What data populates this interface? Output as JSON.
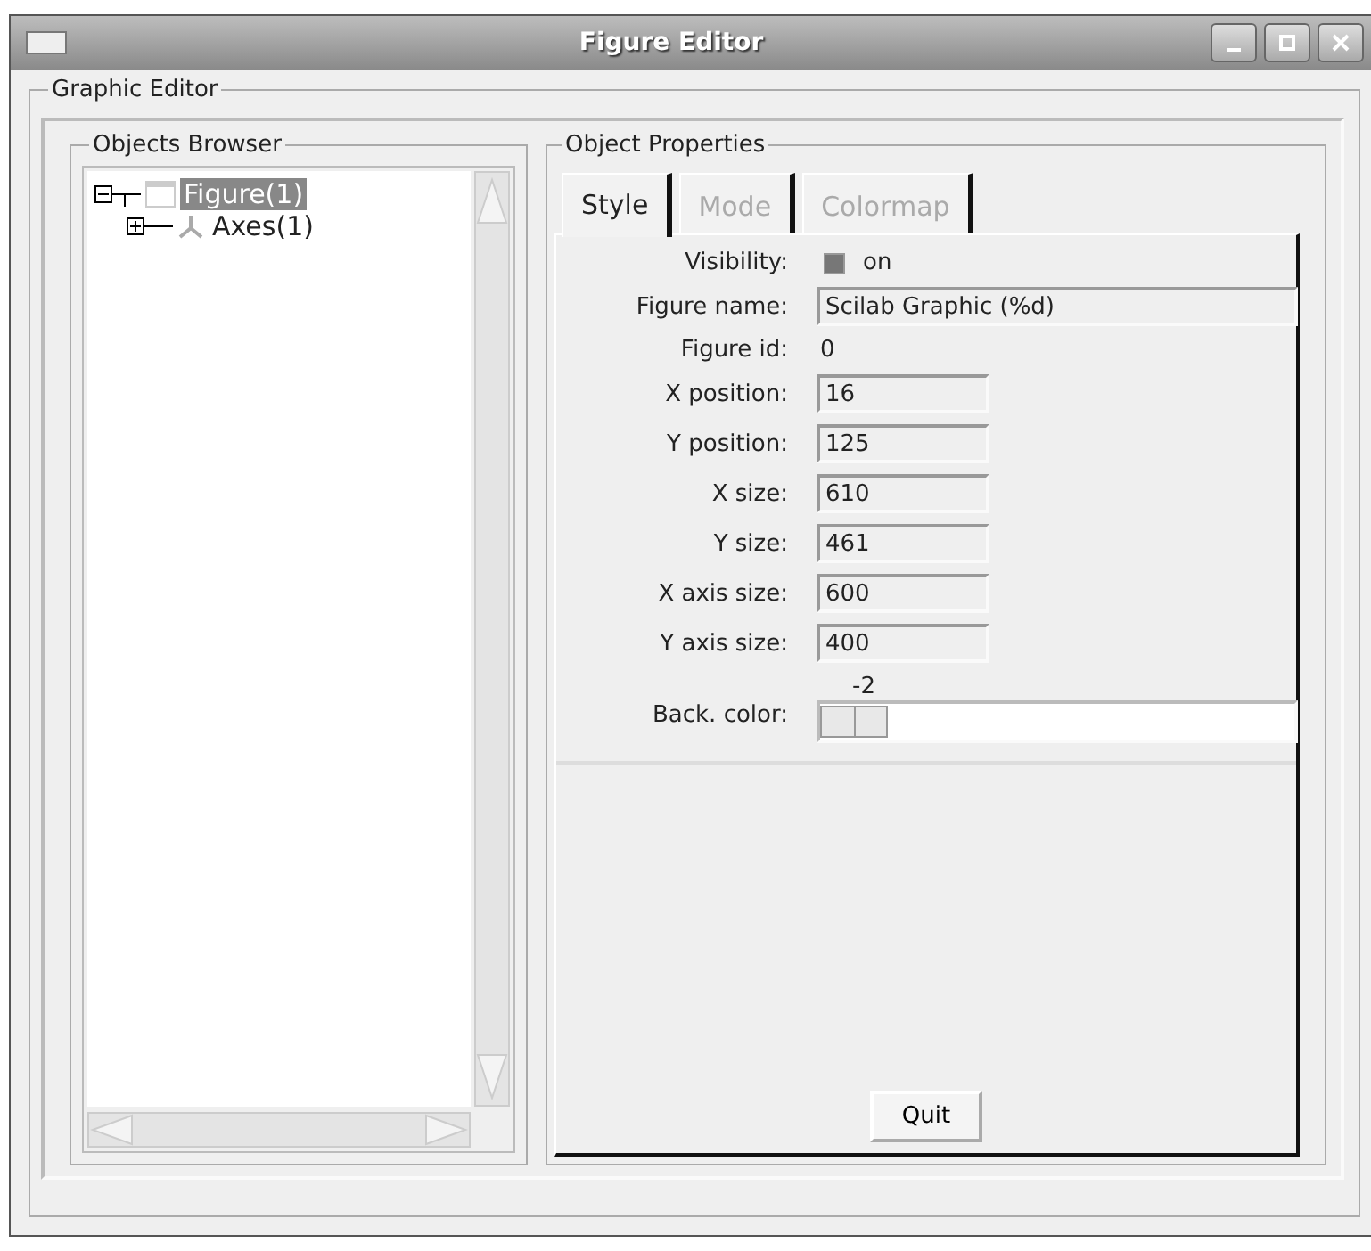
{
  "window": {
    "title": "Figure Editor"
  },
  "group": {
    "title": "Graphic Editor"
  },
  "browser": {
    "title": "Objects Browser",
    "tree": [
      {
        "label": "Figure(1)",
        "selected": true,
        "expanded": true,
        "children": [
          {
            "label": "Axes(1)",
            "selected": false,
            "expanded": false
          }
        ]
      }
    ]
  },
  "properties": {
    "title": "Object Properties",
    "tabs": [
      {
        "label": "Style",
        "selected": true,
        "disabled": false
      },
      {
        "label": "Mode",
        "selected": false,
        "disabled": true
      },
      {
        "label": "Colormap",
        "selected": false,
        "disabled": true
      }
    ],
    "fields": [
      {
        "kind": "checkbox",
        "label": "Visibility:",
        "value": "on",
        "checked": true
      },
      {
        "kind": "wide-input",
        "label": "Figure name:",
        "value": "Scilab Graphic (%d)"
      },
      {
        "kind": "text",
        "label": "Figure id:",
        "value": "0"
      },
      {
        "kind": "input",
        "label": "X position:",
        "value": "16"
      },
      {
        "kind": "input",
        "label": "Y position:",
        "value": "125"
      },
      {
        "kind": "input",
        "label": "X size:",
        "value": "610"
      },
      {
        "kind": "input",
        "label": "Y size:",
        "value": "461"
      },
      {
        "kind": "input",
        "label": "X axis size:",
        "value": "600"
      },
      {
        "kind": "input",
        "label": "Y axis size:",
        "value": "400"
      },
      {
        "kind": "slider",
        "label": "Back. color:",
        "reading": "-2",
        "level": 0
      }
    ],
    "quit": "Quit"
  }
}
